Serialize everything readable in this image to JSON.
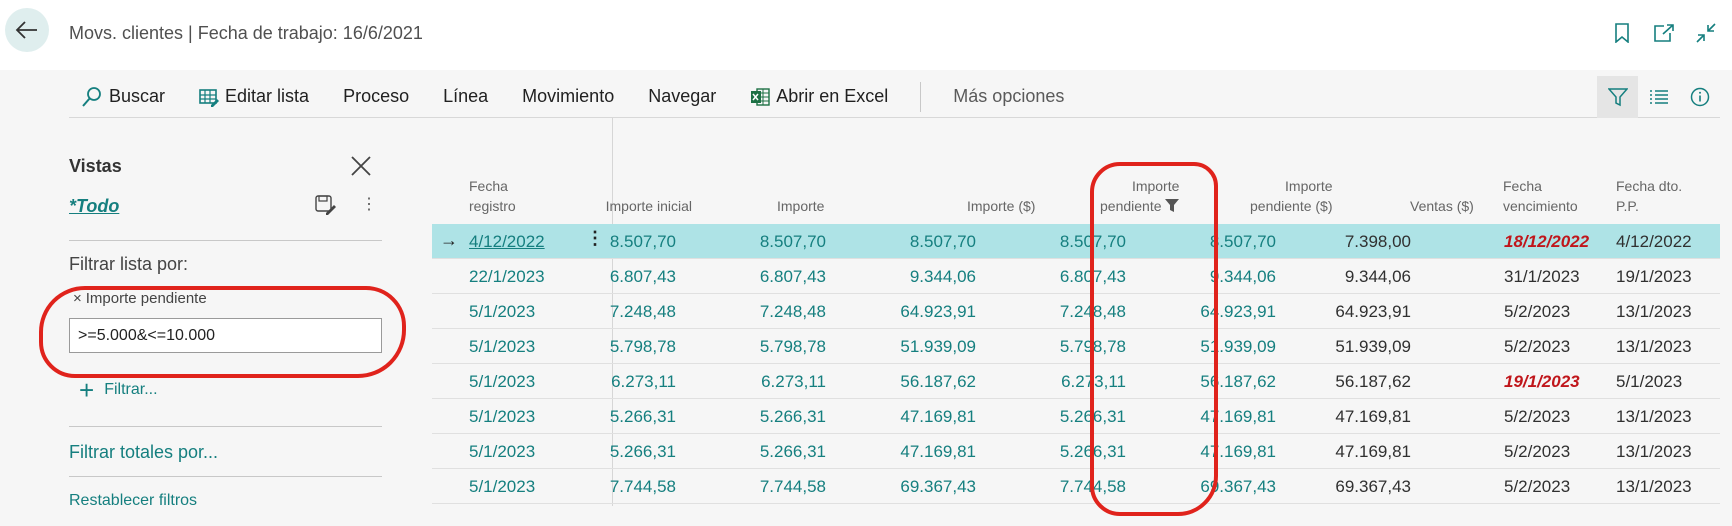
{
  "header": {
    "title": "Movs. clientes | Fecha de trabajo: 16/6/2021"
  },
  "toolbar": {
    "buscar": "Buscar",
    "editar_lista": "Editar lista",
    "proceso": "Proceso",
    "linea": "Línea",
    "movimiento": "Movimiento",
    "navegar": "Navegar",
    "abrir_excel": "Abrir en Excel",
    "mas_opciones": "Más opciones"
  },
  "filter_pane": {
    "vistas": "Vistas",
    "current_view": "*Todo",
    "filtrar_lista_por": "Filtrar lista por:",
    "filter_field": "Importe pendiente",
    "filter_value": ">=5.000&<=10.000",
    "add_filter": "Filtrar...",
    "filtrar_totales": "Filtrar totales por...",
    "restablecer": "Restablecer filtros"
  },
  "table": {
    "columns": {
      "fecha_registro": [
        "Fecha",
        "registro"
      ],
      "importe_inicial": "Importe inicial",
      "importe": "Importe",
      "importe_usd": "Importe ($)",
      "importe_pendiente": [
        "Importe",
        "pendiente"
      ],
      "importe_pendiente_usd": [
        "Importe",
        "pendiente ($)"
      ],
      "ventas_usd": "Ventas ($)",
      "fecha_vencimiento": [
        "Fecha",
        "vencimiento"
      ],
      "fecha_dto": [
        "Fecha dto.",
        "P.P."
      ]
    },
    "rows": [
      {
        "fecha": "4/12/2022",
        "inicial": "8.507,70",
        "importe": "8.507,70",
        "importe_usd": "8.507,70",
        "pendiente": "8.507,70",
        "pendiente_usd": "8.507,70",
        "ventas": "7.398,00",
        "venc": "18/12/2022",
        "dto": "4/12/2022",
        "venc_overdue": true,
        "selected": true
      },
      {
        "fecha": "22/1/2023",
        "inicial": "6.807,43",
        "importe": "6.807,43",
        "importe_usd": "9.344,06",
        "pendiente": "6.807,43",
        "pendiente_usd": "9.344,06",
        "ventas": "9.344,06",
        "venc": "31/1/2023",
        "dto": "19/1/2023",
        "venc_overdue": false,
        "selected": false
      },
      {
        "fecha": "5/1/2023",
        "inicial": "7.248,48",
        "importe": "7.248,48",
        "importe_usd": "64.923,91",
        "pendiente": "7.248,48",
        "pendiente_usd": "64.923,91",
        "ventas": "64.923,91",
        "venc": "5/2/2023",
        "dto": "13/1/2023",
        "venc_overdue": false,
        "selected": false
      },
      {
        "fecha": "5/1/2023",
        "inicial": "5.798,78",
        "importe": "5.798,78",
        "importe_usd": "51.939,09",
        "pendiente": "5.798,78",
        "pendiente_usd": "51.939,09",
        "ventas": "51.939,09",
        "venc": "5/2/2023",
        "dto": "13/1/2023",
        "venc_overdue": false,
        "selected": false
      },
      {
        "fecha": "5/1/2023",
        "inicial": "6.273,11",
        "importe": "6.273,11",
        "importe_usd": "56.187,62",
        "pendiente": "6.273,11",
        "pendiente_usd": "56.187,62",
        "ventas": "56.187,62",
        "venc": "19/1/2023",
        "dto": "5/1/2023",
        "venc_overdue": true,
        "selected": false
      },
      {
        "fecha": "5/1/2023",
        "inicial": "5.266,31",
        "importe": "5.266,31",
        "importe_usd": "47.169,81",
        "pendiente": "5.266,31",
        "pendiente_usd": "47.169,81",
        "ventas": "47.169,81",
        "venc": "5/2/2023",
        "dto": "13/1/2023",
        "venc_overdue": false,
        "selected": false
      },
      {
        "fecha": "5/1/2023",
        "inicial": "5.266,31",
        "importe": "5.266,31",
        "importe_usd": "47.169,81",
        "pendiente": "5.266,31",
        "pendiente_usd": "47.169,81",
        "ventas": "47.169,81",
        "venc": "5/2/2023",
        "dto": "13/1/2023",
        "venc_overdue": false,
        "selected": false
      },
      {
        "fecha": "5/1/2023",
        "inicial": "7.744,58",
        "importe": "7.744,58",
        "importe_usd": "69.367,43",
        "pendiente": "7.744,58",
        "pendiente_usd": "69.367,43",
        "ventas": "69.367,43",
        "venc": "5/2/2023",
        "dto": "13/1/2023",
        "venc_overdue": false,
        "selected": false
      }
    ]
  },
  "colors": {
    "accent": "#157f7f",
    "selected_row": "#aee3e6",
    "overdue": "#c0161b",
    "annotation": "#e0231c"
  },
  "icons": [
    "back-arrow-icon",
    "bookmark-icon",
    "open-new-window-icon",
    "collapse-icon",
    "search-icon",
    "edit-list-icon",
    "excel-icon",
    "filter-icon",
    "list-icon",
    "info-icon",
    "close-icon",
    "save-view-icon",
    "more-icon",
    "plus-icon",
    "row-arrow-icon"
  ]
}
